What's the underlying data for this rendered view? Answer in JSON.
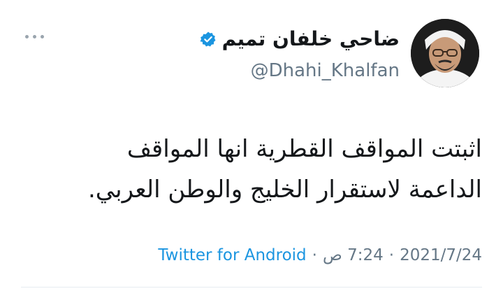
{
  "tweet": {
    "display_name": "ضاحي خلفان تميم",
    "handle": "@Dhahi_Khalfan",
    "verified_icon": "verified-badge-icon",
    "more_icon": "more-options-icon",
    "text_line_1": "اثبتت المواقف القطرية انها المواقف",
    "text_line_2": "الداعمة لاستقرار الخليج والوطن العربي.",
    "date": "2021/7/24",
    "time": "7:24 ص",
    "separator": "·",
    "source": "Twitter for Android"
  },
  "colors": {
    "accent": "#1b95e0",
    "secondary_text": "#657786",
    "primary_text": "#14171a"
  }
}
